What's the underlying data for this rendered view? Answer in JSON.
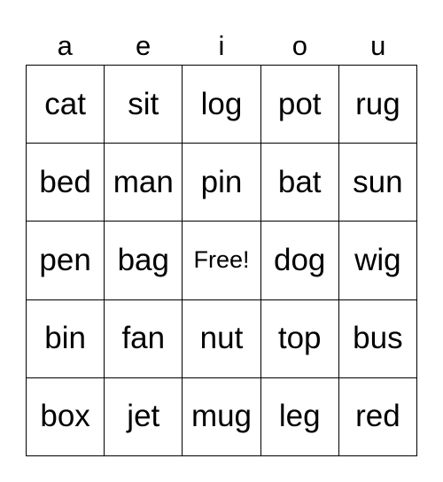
{
  "header": [
    "a",
    "e",
    "i",
    "o",
    "u"
  ],
  "cells": [
    [
      "cat",
      "sit",
      "log",
      "pot",
      "rug"
    ],
    [
      "bed",
      "man",
      "pin",
      "bat",
      "sun"
    ],
    [
      "pen",
      "bag",
      "Free!",
      "dog",
      "wig"
    ],
    [
      "bin",
      "fan",
      "nut",
      "top",
      "bus"
    ],
    [
      "box",
      "jet",
      "mug",
      "leg",
      "red"
    ]
  ]
}
